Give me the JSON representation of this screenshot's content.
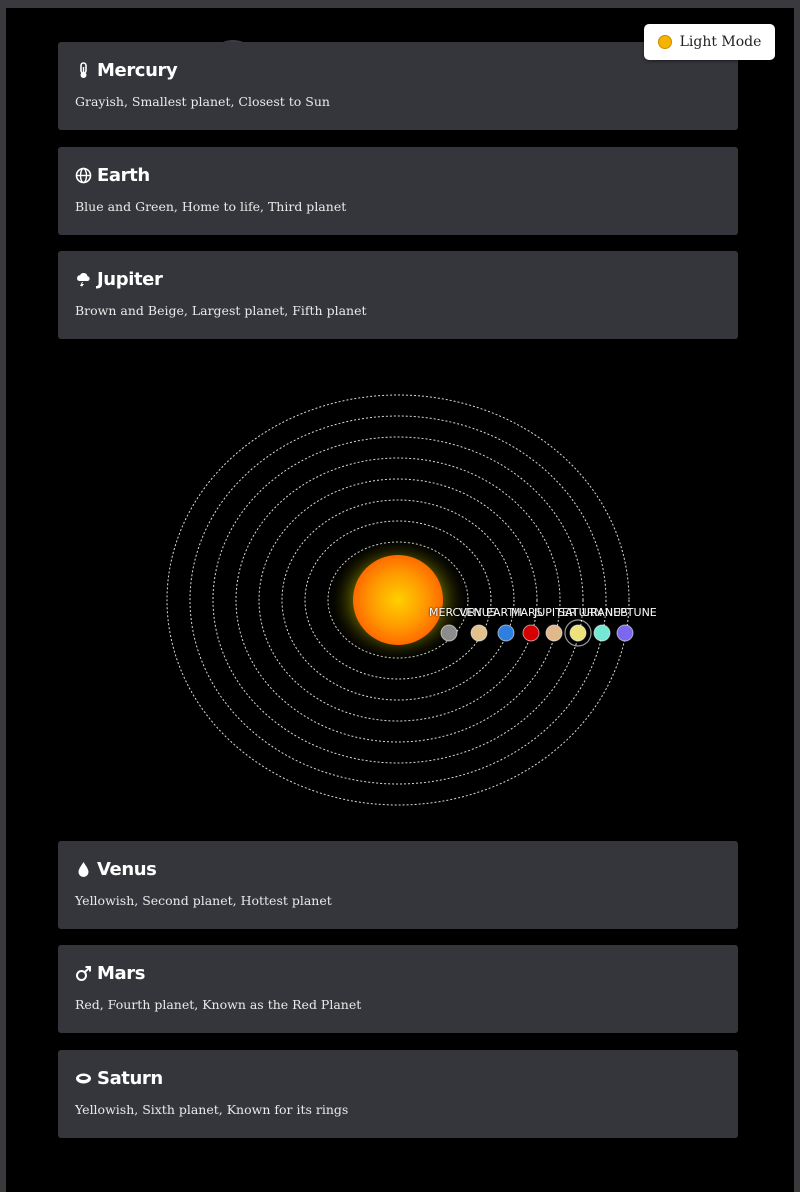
{
  "theme_toggle": {
    "label": "Light Mode",
    "icon": "sun-icon"
  },
  "cards_top": [
    {
      "title": "Mercury",
      "icon": "thermometer-icon",
      "description": "Grayish, Smallest planet, Closest to Sun"
    },
    {
      "title": "Earth",
      "icon": "globe-icon",
      "description": "Blue and Green, Home to life, Third planet"
    },
    {
      "title": "Jupiter",
      "icon": "storm-cloud-icon",
      "description": "Brown and Beige, Largest planet, Fifth planet"
    }
  ],
  "cards_bottom": [
    {
      "title": "Venus",
      "icon": "droplet-icon",
      "description": "Yellowish, Second planet, Hottest planet"
    },
    {
      "title": "Mars",
      "icon": "mars-symbol-icon",
      "description": "Red, Fourth planet, Known as the Red Planet"
    },
    {
      "title": "Saturn",
      "icon": "ring-icon",
      "description": "Yellowish, Sixth planet, Known for its rings"
    }
  ],
  "solar_system": {
    "sun_color": "#ffb300",
    "orbit_color": "#ffffff",
    "planets": [
      {
        "label": "MERCURY",
        "color": "#8c8c8c"
      },
      {
        "label": "VENUS",
        "color": "#e3c18a"
      },
      {
        "label": "EARTH",
        "color": "#2f7fe0"
      },
      {
        "label": "MARS",
        "color": "#d40000"
      },
      {
        "label": "JUPITER",
        "color": "#e0b88a"
      },
      {
        "label": "SATURN",
        "color": "#ede27a"
      },
      {
        "label": "URANUS",
        "color": "#74e8d4"
      },
      {
        "label": "NEPTUNE",
        "color": "#7b68ee"
      }
    ]
  }
}
